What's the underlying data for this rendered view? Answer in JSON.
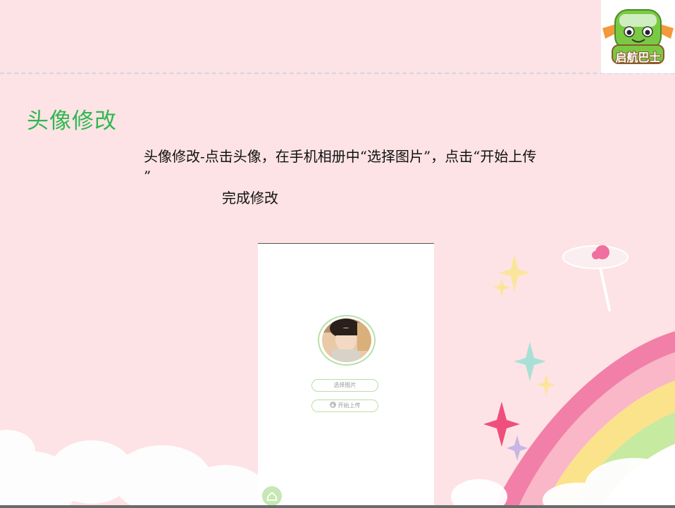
{
  "logo": {
    "text": "启航巴士",
    "icon": "green-bus-mascot-with-wings"
  },
  "slide": {
    "title": "头像修改",
    "description_line1": "头像修改-点击头像，在手机相册中“选择图片”，点击“开始上传",
    "description_line2": "”",
    "description_line3": "完成修改"
  },
  "phone": {
    "avatar_icon": "user-avatar-photo",
    "select_button_label": "选择图片",
    "upload_button_label": "开始上传",
    "upload_icon": "upload-arrow-icon",
    "home_icon": "home-icon"
  },
  "colors": {
    "background": "#fde3e5",
    "title_green": "#2db84f",
    "button_border": "#b8e0a6"
  }
}
